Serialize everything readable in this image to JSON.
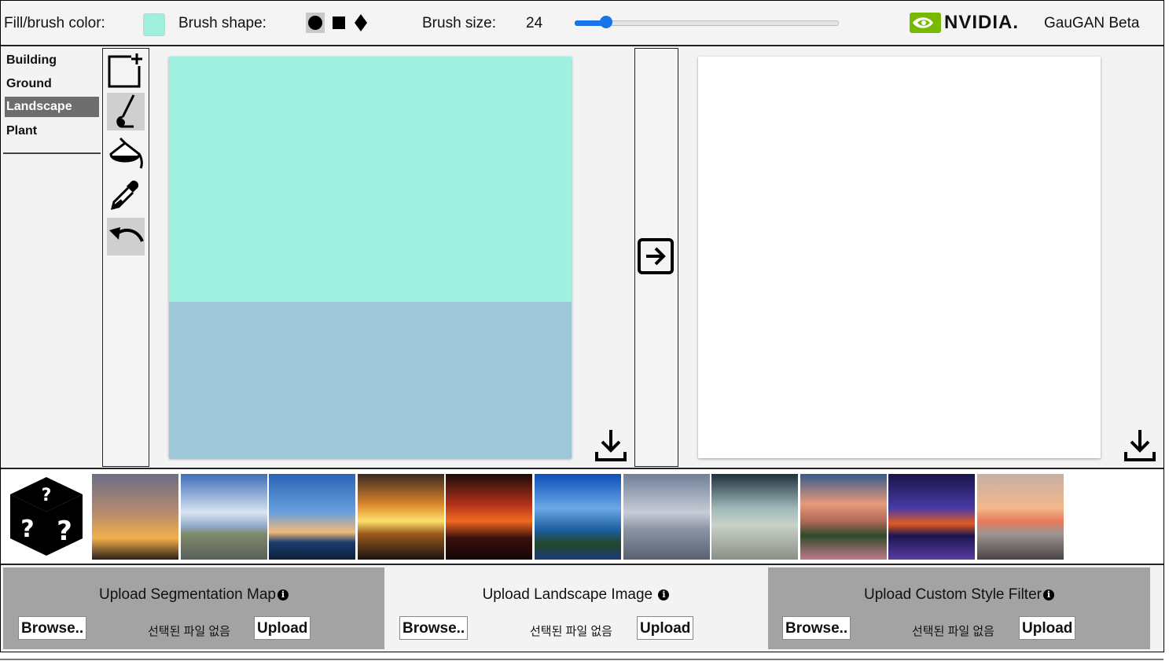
{
  "toolbar": {
    "fill_color_label": "Fill/brush color:",
    "fill_color": "#9ff0de",
    "brush_shape_label": "Brush shape:",
    "brush_shapes": [
      "circle",
      "square",
      "diamond"
    ],
    "selected_shape": "circle",
    "brush_size_label": "Brush size:",
    "brush_size_value": "24",
    "brush_size_fraction": 0.12,
    "brand": "NVIDIA.",
    "app_title": "GauGAN Beta"
  },
  "labels": {
    "items": [
      "Building",
      "Ground",
      "Landscape",
      "Plant"
    ],
    "selected": "Landscape"
  },
  "tools": [
    "new-canvas-icon",
    "brush-icon",
    "fill-bucket-icon",
    "eyedropper-icon",
    "undo-icon"
  ],
  "canvas": {
    "sky_color": "#9ff0de",
    "water_color": "#9ec7d8"
  },
  "colors": {
    "accent": "#1a73e8",
    "nvidia_green": "#76b900",
    "panel_gray": "#a3a3a3"
  },
  "thumbnails": [
    "sunset-trees",
    "road-clouds",
    "lake-dusk",
    "sunset-sea",
    "red-sunset",
    "coast-cliff",
    "gray-beach",
    "beach-palm",
    "pink-clouds",
    "purple-night",
    "calm-sunset"
  ],
  "uploads": [
    {
      "title": "Upload Segmentation Map",
      "browse": "Browse..",
      "no_file": "선택된 파일 없음",
      "upload": "Upload"
    },
    {
      "title": "Upload Landscape Image",
      "browse": "Browse..",
      "no_file": "선택된 파일 없음",
      "upload": "Upload"
    },
    {
      "title": "Upload Custom Style Filter",
      "browse": "Browse..",
      "no_file": "선택된 파일 없음",
      "upload": "Upload"
    }
  ]
}
